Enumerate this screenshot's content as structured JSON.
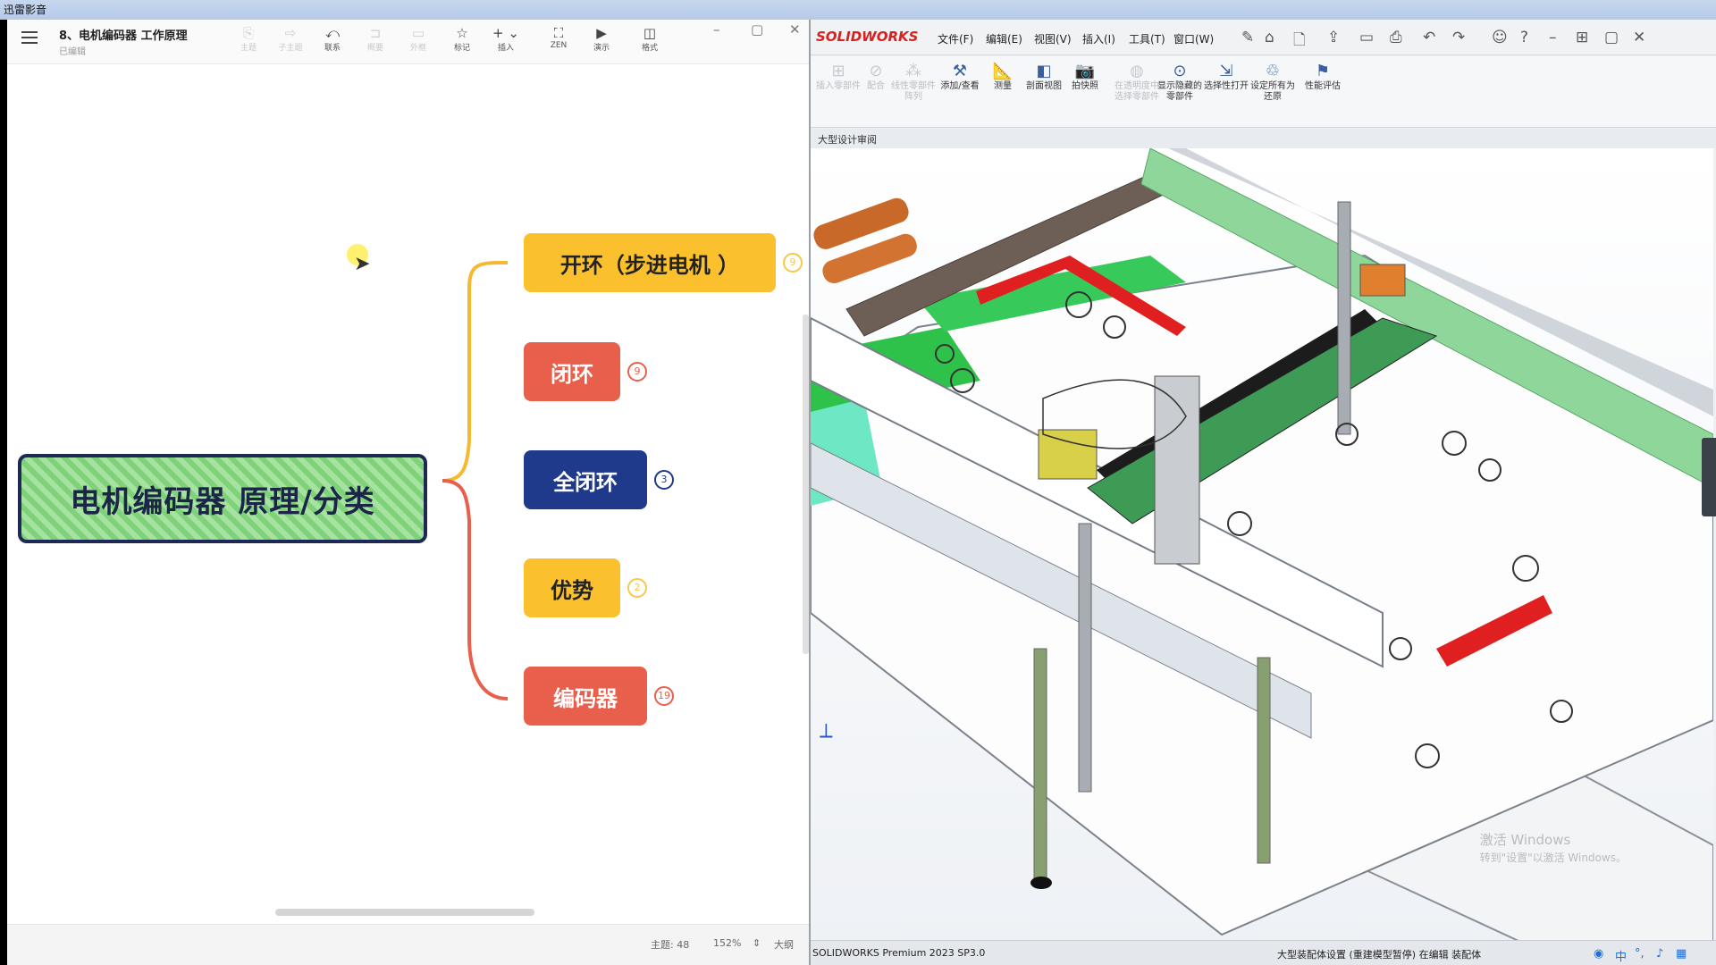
{
  "player": {
    "title": "迅雷影音"
  },
  "mindmap": {
    "file_title": "8、电机编码器 工作原理",
    "file_status": "已编辑",
    "toolbar": [
      {
        "label": "主题",
        "glyph": "⎘",
        "enabled": false
      },
      {
        "label": "子主题",
        "glyph": "⇨",
        "enabled": false
      },
      {
        "label": "联系",
        "glyph": "⤺",
        "enabled": true
      },
      {
        "label": "概要",
        "glyph": "⊐",
        "enabled": false
      },
      {
        "label": "外框",
        "glyph": "▭",
        "enabled": false
      },
      {
        "label": "标记",
        "glyph": "☆",
        "enabled": true
      },
      {
        "label": "插入",
        "glyph": "+ ⌄",
        "enabled": true
      },
      {
        "label": "ZEN",
        "glyph": "⛶",
        "enabled": true
      },
      {
        "label": "演示",
        "glyph": "▶",
        "enabled": true
      },
      {
        "label": "格式",
        "glyph": "◫",
        "enabled": true
      }
    ],
    "central_topic": "电机编码器  原理/分类",
    "branches": [
      {
        "label": "开环（步进电机 ）",
        "count": "9",
        "fill": "#fbc02d",
        "text_color": "#222222",
        "badge_color": "#f7c948"
      },
      {
        "label": "闭环",
        "count": "9",
        "fill": "#e8604c",
        "text_color": "#ffffff",
        "badge_color": "#e8604c"
      },
      {
        "label": "全闭环",
        "count": "3",
        "fill": "#1f3a8a",
        "text_color": "#ffffff",
        "badge_color": "#1f3a8a"
      },
      {
        "label": "优势",
        "count": "2",
        "fill": "#fbc02d",
        "text_color": "#222222",
        "badge_color": "#f7c948"
      },
      {
        "label": "编码器",
        "count": "19",
        "fill": "#e8604c",
        "text_color": "#ffffff",
        "badge_color": "#e8604c"
      }
    ],
    "status": {
      "topics": "主题: 48",
      "zoom": "152%",
      "outline": "大纲"
    }
  },
  "solidworks": {
    "logo": "SOLIDWORKS",
    "menu": [
      "文件(F)",
      "编辑(E)",
      "视图(V)",
      "插入(I)",
      "工具(T)",
      "窗口(W)"
    ],
    "ribbon": [
      {
        "label": "插入零部件",
        "glyph": "⊞",
        "enabled": false
      },
      {
        "label": "配合",
        "glyph": "⊘",
        "enabled": false
      },
      {
        "label": "线性零部件阵列",
        "glyph": "⁂",
        "enabled": false
      },
      {
        "label": "添加/查看",
        "glyph": "⚒",
        "enabled": true
      },
      {
        "label": "测量",
        "glyph": "📐",
        "enabled": true
      },
      {
        "label": "剖面视图",
        "glyph": "◧",
        "enabled": true
      },
      {
        "label": "拍快照",
        "glyph": "📷",
        "enabled": true
      },
      {
        "label": "在透明度中选择零部件",
        "glyph": "◍",
        "enabled": false
      },
      {
        "label": "显示隐藏的零部件",
        "glyph": "⊙",
        "enabled": true
      },
      {
        "label": "选择性打开",
        "glyph": "⇲",
        "enabled": true
      },
      {
        "label": "设定所有为还原",
        "glyph": "♲",
        "enabled": true
      },
      {
        "label": "性能评估",
        "glyph": "⚑",
        "enabled": true
      }
    ],
    "doc_tab": "大型设计审阅",
    "status_left": "SOLIDWORKS Premium 2023 SP3.0",
    "status_right": "大型装配体设置 (重建模型暂停)   在编辑 装配体",
    "activate_windows": "激活 Windows",
    "activate_hint": "转到\"设置\"以激活 Windows。"
  },
  "tray": {
    "ime": "中"
  }
}
